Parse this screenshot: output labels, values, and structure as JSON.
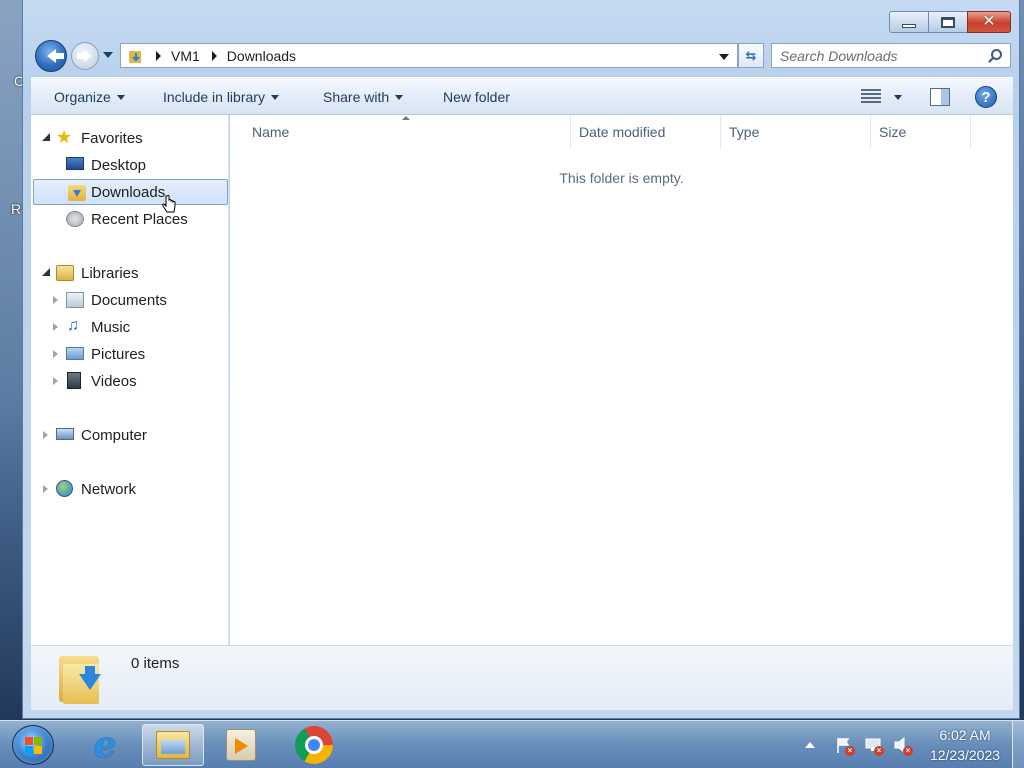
{
  "desktop": {
    "char1": "C",
    "char2": "R"
  },
  "window": {
    "caption": {
      "minimize": "minimize",
      "maximize": "maximize",
      "close": "close"
    }
  },
  "address": {
    "segments": [
      "VM1",
      "Downloads"
    ]
  },
  "search": {
    "placeholder": "Search Downloads"
  },
  "toolbar": {
    "organize": "Organize",
    "include_in_library": "Include in library",
    "share_with": "Share with",
    "new_folder": "New folder"
  },
  "nav": {
    "favorites": "Favorites",
    "desktop": "Desktop",
    "downloads": "Downloads",
    "recent_places": "Recent Places",
    "libraries": "Libraries",
    "documents": "Documents",
    "music": "Music",
    "pictures": "Pictures",
    "videos": "Videos",
    "computer": "Computer",
    "network": "Network"
  },
  "columns": [
    "Name",
    "Date modified",
    "Type",
    "Size"
  ],
  "content": {
    "empty_message": "This folder is empty."
  },
  "details": {
    "item_count": "0 items"
  },
  "taskbar": {
    "clock_time": "6:02 AM",
    "clock_date": "12/23/2023"
  },
  "colors": {
    "accent": "#2f6fc0",
    "selection_border": "#7da2ce",
    "close_button": "#c7412b"
  }
}
